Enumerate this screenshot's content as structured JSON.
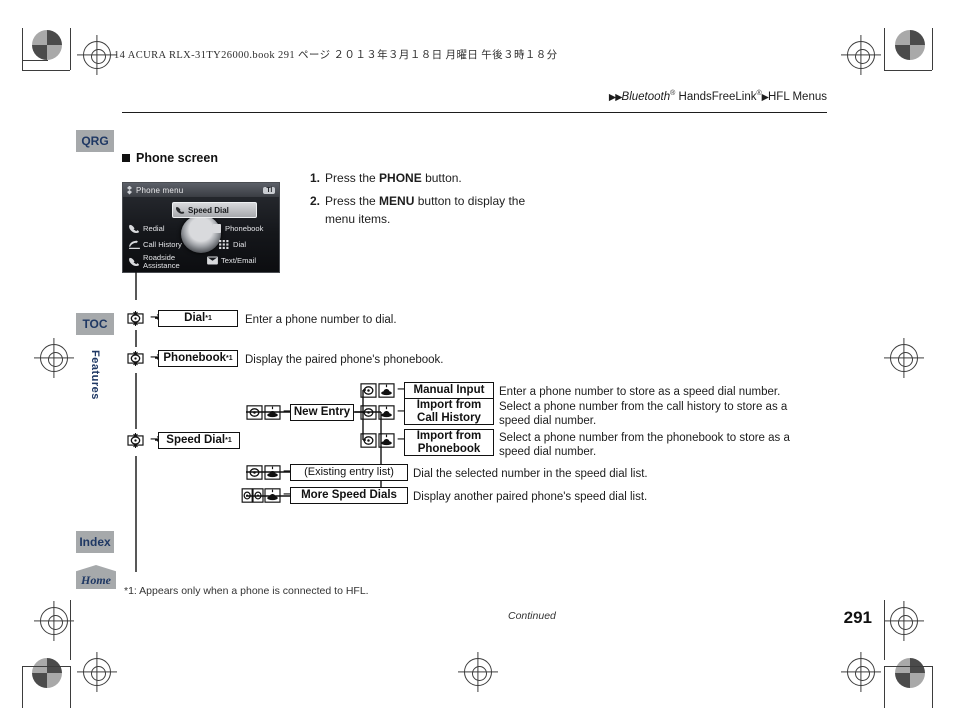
{
  "print_header": "14 ACURA RLX-31TY26000.book  291 ページ   ２０１３年３月１８日   月曜日   午後３時１８分",
  "running_head": {
    "prefix_arrows": "▶▶",
    "part1": "Bluetooth",
    "reg1": "®",
    "part2": " HandsFreeLink",
    "reg2": "®",
    "mid_arrow": "▶",
    "part3": "HFL Menus"
  },
  "tabs": {
    "qrg": "QRG",
    "toc": "TOC",
    "features": "Features",
    "index": "Index",
    "home": "Home"
  },
  "section": {
    "heading": "Phone screen"
  },
  "steps": [
    {
      "num": "1.",
      "pre": "Press the ",
      "bold": "PHONE",
      "post": " button."
    },
    {
      "num": "2.",
      "pre": "Press the ",
      "bold": "MENU",
      "post": " button to display the menu items."
    }
  ],
  "nav_screen": {
    "title": "Phone menu",
    "status_icon": "bluetooth-icon",
    "signal_badge": "Tl",
    "highlight": {
      "label": "Speed Dial",
      "icon": "phone-icon"
    },
    "items": [
      {
        "label": "Redial",
        "icon": "phone-icon",
        "col": "left"
      },
      {
        "label": "Phonebook",
        "icon": "contacts-icon",
        "col": "right"
      },
      {
        "label": "Call History",
        "icon": "history-icon",
        "col": "left"
      },
      {
        "label": "Dial",
        "icon": "keypad-icon",
        "col": "right"
      },
      {
        "label": "Roadside Assistance",
        "icon": "roadside-icon",
        "col": "left"
      },
      {
        "label": "Text/Email",
        "icon": "mail-icon",
        "col": "right"
      }
    ]
  },
  "flow": {
    "rows": [
      {
        "id": "dial",
        "icons": [
          "rotary-knob-icon"
        ],
        "label": "Dial",
        "footnote_mark": "*1",
        "desc": "Enter a phone number to dial."
      },
      {
        "id": "phonebook",
        "icons": [
          "rotary-knob-icon"
        ],
        "label": "Phonebook",
        "footnote_mark": "*1",
        "desc": "Display the paired phone's phonebook."
      },
      {
        "id": "speed-dial",
        "icons": [
          "rotary-knob-icon"
        ],
        "label": "Speed Dial",
        "footnote_mark": "*1",
        "desc": ""
      }
    ],
    "new_entry": {
      "icons": [
        "rotary-knob-icon",
        "enter-press-icon"
      ],
      "label": "New Entry",
      "children": [
        {
          "icons": [
            "rotary-knob-icon",
            "enter-press-icon"
          ],
          "label": "Manual Input",
          "desc": "Enter a phone number to store as a speed dial number."
        },
        {
          "icons": [
            "rotary-knob-icon",
            "enter-press-icon"
          ],
          "label": "Import from Call History",
          "desc": "Select a phone number from the call history to store as a speed dial number."
        },
        {
          "icons": [
            "rotary-knob-icon",
            "enter-press-icon"
          ],
          "label": "Import from Phonebook",
          "desc": "Select a phone number from the phonebook to store as a speed dial number."
        }
      ]
    },
    "existing_entry": {
      "icons": [
        "rotary-knob-icon",
        "enter-press-icon"
      ],
      "label": "(Existing entry list)",
      "desc": "Dial the selected number in the speed dial list."
    },
    "more_speed_dials": {
      "icons": [
        "rotary-knob-updown-icon",
        "enter-press-icon"
      ],
      "label": "More Speed Dials",
      "desc": "Display another paired phone's speed dial list."
    }
  },
  "footnote": "*1: Appears only when a phone is connected to HFL.",
  "footer": {
    "continued": "Continued",
    "page_number": "291"
  },
  "colors": {
    "tab_background": "#a6a9ab",
    "tab_text": "#1f3864",
    "ink": "#231f20"
  }
}
